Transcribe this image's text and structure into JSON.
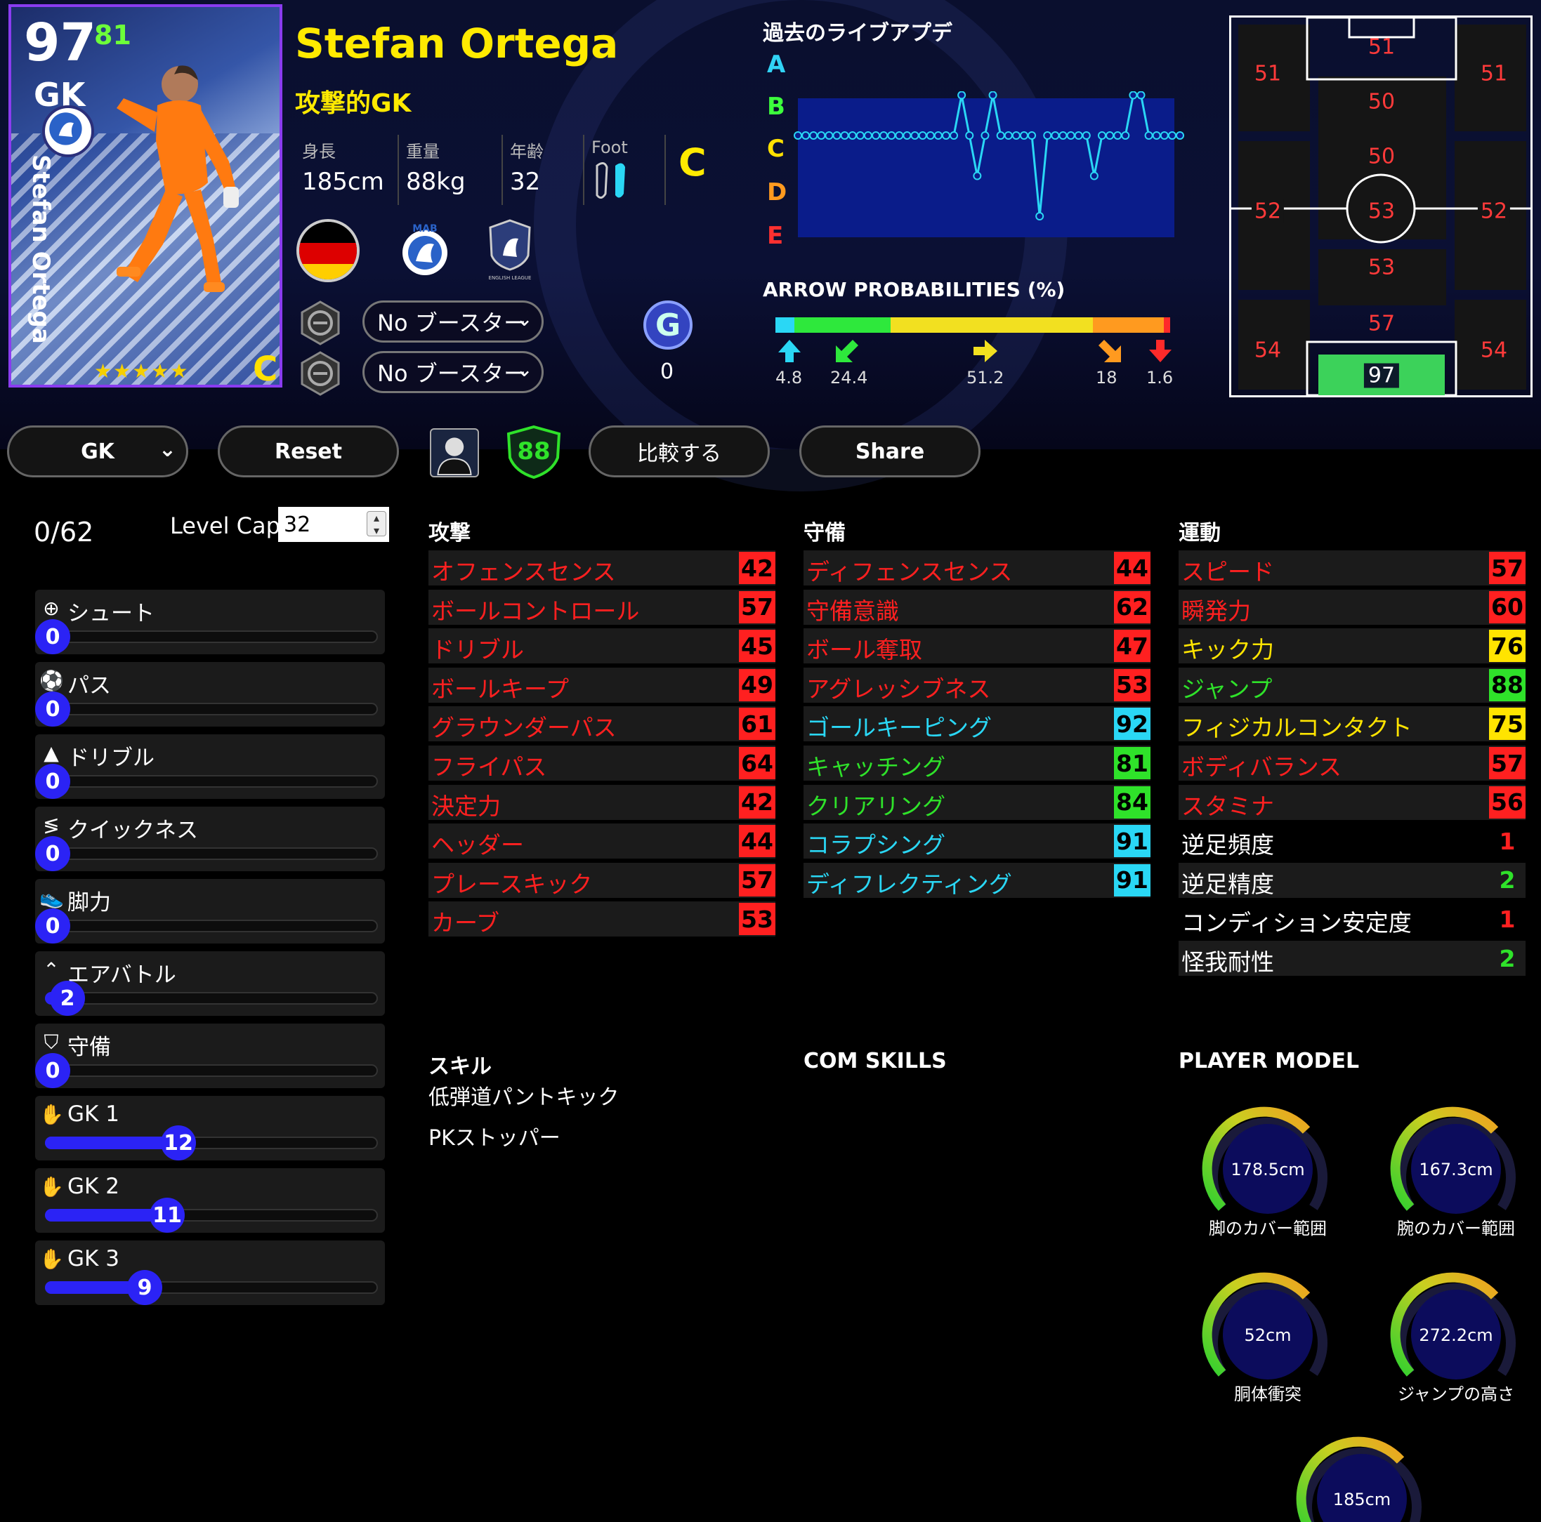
{
  "card": {
    "rating": "97",
    "sub_rating": "81",
    "position": "GK",
    "vertical_name": "Stefan Ortega",
    "card_grade": "C",
    "stars": "★★★★★"
  },
  "player": {
    "name": "Stefan Ortega",
    "style": "攻撃的GK",
    "height_label": "身長",
    "height": "185cm",
    "weight_label": "重量",
    "weight": "88kg",
    "age_label": "年齢",
    "age": "32",
    "foot_label": "Foot",
    "condition": "C"
  },
  "badges": {
    "club_text": "MAB",
    "league_text": "ENGLISH LEAGUE"
  },
  "booster": {
    "slot1": "No ブースター",
    "slot2": "No ブースター",
    "g_badge": "G",
    "g_value": "0"
  },
  "history": {
    "title": "過去のライブアプデ",
    "letters": [
      "A",
      "B",
      "C",
      "D",
      "E"
    ],
    "letter_colors": [
      "#31d3f5",
      "#3dff3d",
      "#ffe000",
      "#ff9a1f",
      "#ff3030"
    ],
    "grades": [
      3,
      3,
      3,
      3,
      3,
      3,
      3,
      3,
      3,
      3,
      3,
      3,
      3,
      3,
      3,
      3,
      3,
      3,
      3,
      3,
      3,
      2,
      3,
      4,
      3,
      2,
      3,
      3,
      3,
      3,
      3,
      5,
      3,
      3,
      3,
      3,
      3,
      3,
      4,
      3,
      3,
      3,
      3,
      2,
      2,
      3,
      3,
      3,
      3,
      3
    ]
  },
  "arrows": {
    "title": "ARROW PROBABILITIES (%)",
    "segments": [
      4.8,
      24.4,
      51.2,
      18,
      1.6
    ],
    "labels": [
      "4.8",
      "24.4",
      "51.2",
      "18",
      "1.6"
    ],
    "colors": [
      "#2ad7f5",
      "#2ee83c",
      "#f2e020",
      "#ff9a1f",
      "#ff2a2a"
    ]
  },
  "positions": {
    "lwf": "51",
    "cf": "51",
    "rwf": "51",
    "amf": "50",
    "cmf": "50",
    "lmf": "52",
    "cmf2": "53",
    "rmf": "52",
    "dmf": "53",
    "cb": "57",
    "lb": "54",
    "rb": "54",
    "gk": "97"
  },
  "toolbar": {
    "position": "GK",
    "reset": "Reset",
    "rating_badge": "88",
    "compare": "比較する",
    "share": "Share"
  },
  "progression": {
    "points": "0/62",
    "level_cap_label": "Level Cap",
    "level_cap": "32",
    "items": [
      {
        "label": "シュート",
        "value": "0",
        "level": 0
      },
      {
        "label": "パス",
        "value": "0",
        "level": 0
      },
      {
        "label": "ドリブル",
        "value": "0",
        "level": 0
      },
      {
        "label": "クイックネス",
        "value": "0",
        "level": 0
      },
      {
        "label": "脚力",
        "value": "0",
        "level": 0
      },
      {
        "label": "エアバトル",
        "value": "2",
        "level": 2
      },
      {
        "label": "守備",
        "value": "0",
        "level": 0
      },
      {
        "label": "GK 1",
        "value": "12",
        "level": 12
      },
      {
        "label": "GK 2",
        "value": "11",
        "level": 11
      },
      {
        "label": "GK 3",
        "value": "9",
        "level": 9
      }
    ]
  },
  "stats": {
    "attack_title": "攻撃",
    "defense_title": "守備",
    "athletic_title": "運動",
    "attack": [
      {
        "name": "オフェンスセンス",
        "value": "42"
      },
      {
        "name": "ボールコントロール",
        "value": "57"
      },
      {
        "name": "ドリブル",
        "value": "45"
      },
      {
        "name": "ボールキープ",
        "value": "49"
      },
      {
        "name": "グラウンダーパス",
        "value": "61"
      },
      {
        "name": "フライパス",
        "value": "64"
      },
      {
        "name": "決定力",
        "value": "42"
      },
      {
        "name": "ヘッダー",
        "value": "44"
      },
      {
        "name": "プレースキック",
        "value": "57"
      },
      {
        "name": "カーブ",
        "value": "53"
      }
    ],
    "defense": [
      {
        "name": "ディフェンスセンス",
        "value": "44"
      },
      {
        "name": "守備意識",
        "value": "62"
      },
      {
        "name": "ボール奪取",
        "value": "47"
      },
      {
        "name": "アグレッシブネス",
        "value": "53"
      },
      {
        "name": "ゴールキーピング",
        "value": "92"
      },
      {
        "name": "キャッチング",
        "value": "81"
      },
      {
        "name": "クリアリング",
        "value": "84"
      },
      {
        "name": "コラプシング",
        "value": "91"
      },
      {
        "name": "ディフレクティング",
        "value": "91"
      }
    ],
    "athletic": [
      {
        "name": "スピード",
        "value": "57"
      },
      {
        "name": "瞬発力",
        "value": "60"
      },
      {
        "name": "キック力",
        "value": "76"
      },
      {
        "name": "ジャンプ",
        "value": "88"
      },
      {
        "name": "フィジカルコンタクト",
        "value": "75"
      },
      {
        "name": "ボディバランス",
        "value": "57"
      },
      {
        "name": "スタミナ",
        "value": "56"
      },
      {
        "name": "逆足頻度",
        "value": "1"
      },
      {
        "name": "逆足精度",
        "value": "2"
      },
      {
        "name": "コンディション安定度",
        "value": "1"
      },
      {
        "name": "怪我耐性",
        "value": "2"
      }
    ],
    "tier_colors": {
      "red": "#ff2020",
      "yellow": "#ffe400",
      "green": "#2fe22a",
      "cyan": "#2ad7f5"
    }
  },
  "skills": {
    "title": "スキル",
    "items": [
      "低弾道パントキック",
      "PKストッパー"
    ],
    "com_title": "COM SKILLS",
    "model_title": "PLAYER MODEL"
  },
  "model": [
    {
      "value": "178.5cm",
      "label": "脚のカバー範囲"
    },
    {
      "value": "167.3cm",
      "label": "腕のカバー範囲"
    },
    {
      "value": "52cm",
      "label": "胴体衝突"
    },
    {
      "value": "272.2cm",
      "label": "ジャンプの高さ"
    },
    {
      "value": "185cm",
      "label": ""
    }
  ]
}
